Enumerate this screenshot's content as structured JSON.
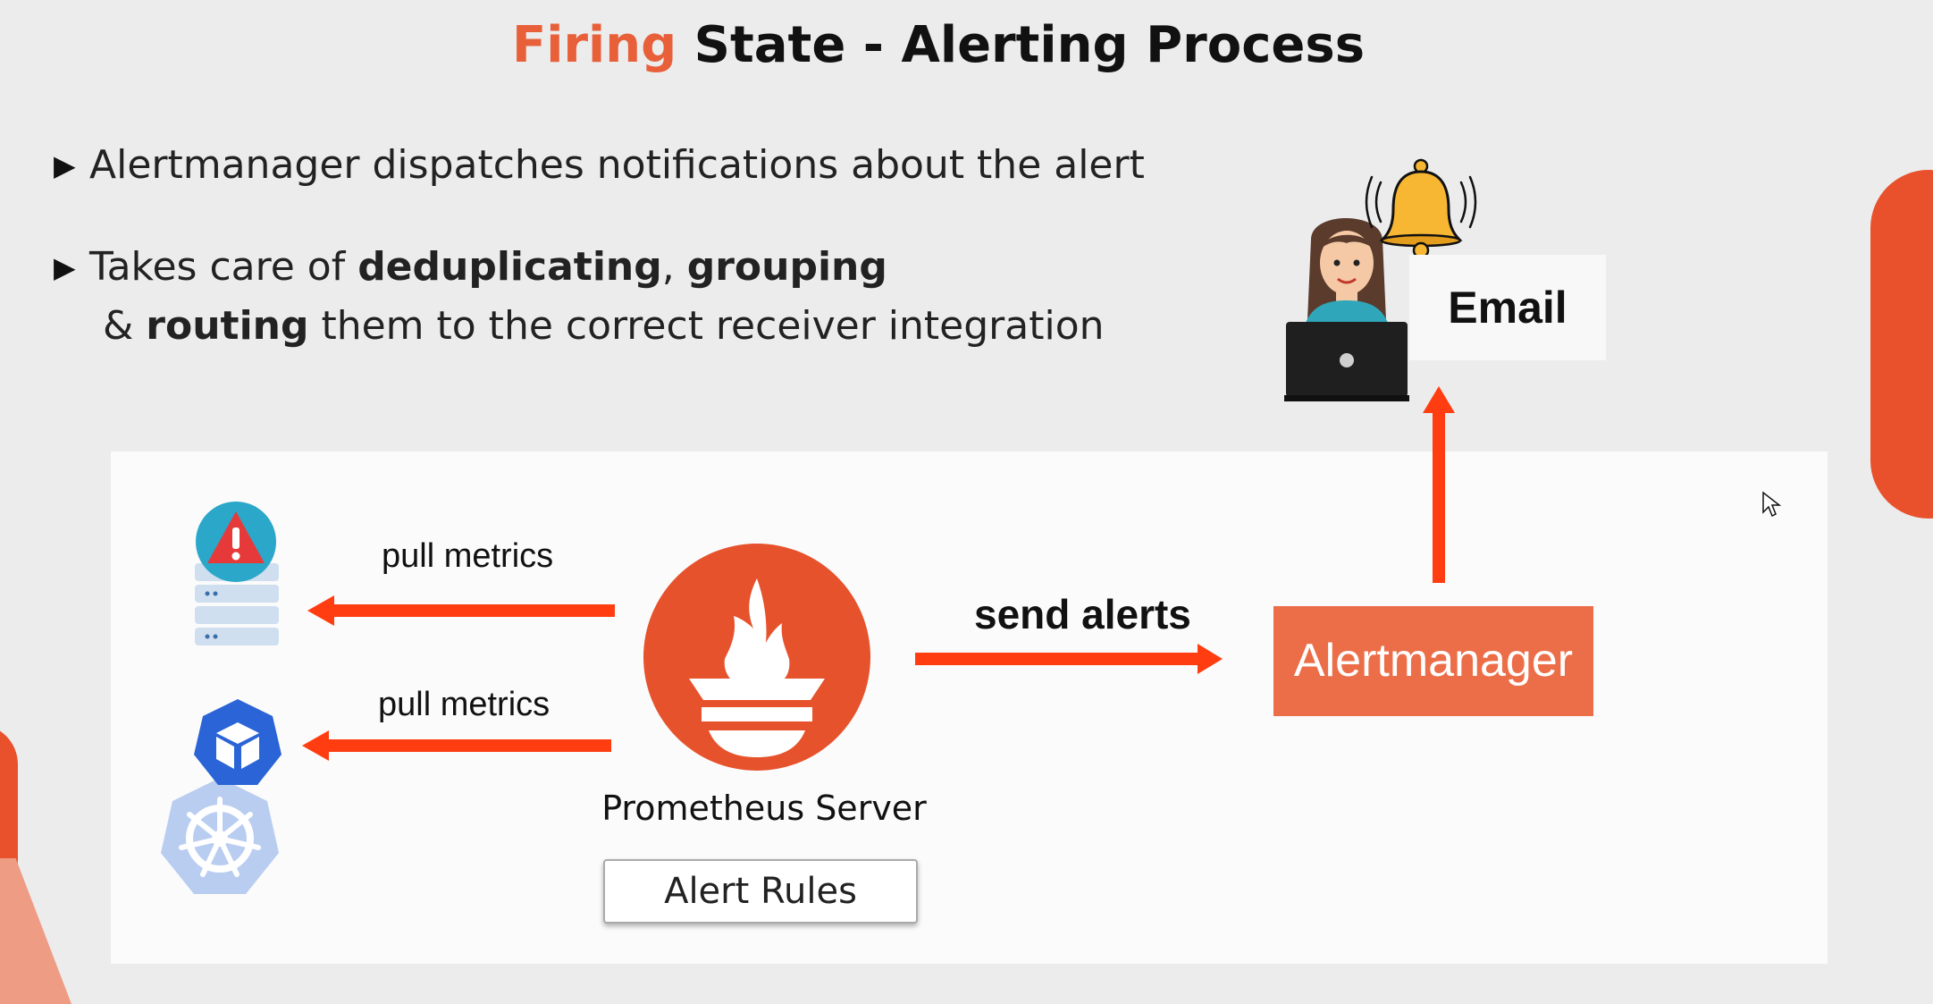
{
  "title": {
    "accent": "Firing",
    "rest": "State - Alerting Process"
  },
  "bullets": [
    {
      "text": "Alertmanager dispatches notifications about the alert"
    },
    {
      "prefix": "Takes care of ",
      "bold1": "deduplicating",
      "sep1": ", ",
      "bold2": "grouping",
      "line2_prefix": "& ",
      "bold3": "routing",
      "line2_rest": " them to the correct receiver integration"
    }
  ],
  "diagram": {
    "pull_label_top": "pull metrics",
    "pull_label_bottom": "pull metrics",
    "send_label": "send alerts",
    "server_label": "Prometheus Server",
    "alert_rules_label": "Alert Rules",
    "alertmanager_label": "Alertmanager",
    "email_label": "Email"
  },
  "colors": {
    "accent": "#e8603a",
    "arrow": "#ff3d10",
    "prometheus": "#e6522c",
    "alertmanager_box": "#ec6e48",
    "kubernetes_pod": "#326ce5"
  },
  "icons": {
    "server": "server-alert-icon",
    "kubernetes": "kubernetes-icon",
    "prometheus": "prometheus-logo-icon",
    "bell": "bell-icon",
    "person": "person-laptop-icon",
    "cursor": "mouse-cursor-icon"
  }
}
